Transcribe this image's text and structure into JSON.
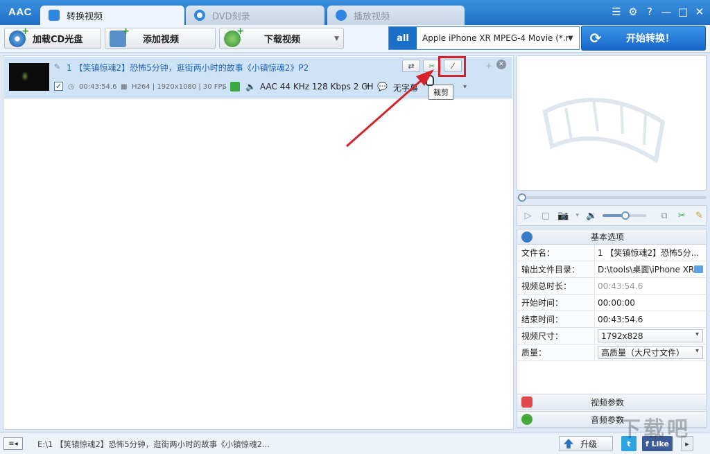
{
  "app": {
    "logo": "AAC"
  },
  "tabs": [
    {
      "label": "转换视频",
      "active": true,
      "icon": "convert-icon"
    },
    {
      "label": "DVD刻录",
      "active": false,
      "icon": "disc-icon"
    },
    {
      "label": "播放视频",
      "active": false,
      "icon": "play-icon"
    }
  ],
  "window_controls": {
    "menu": "☰",
    "settings": "⚙",
    "help": "?",
    "minimize": "—",
    "maximize": "□",
    "close": "✕"
  },
  "toolbar": {
    "load_cd": "加载CD光盘",
    "add_video": "添加视频",
    "download_video": "下载视频",
    "profile_icon_text": "all",
    "profile": "Apple iPhone XR MPEG-4 Movie (*.m...",
    "start": "开始转换！"
  },
  "file": {
    "index": "1",
    "name": "【笑镇惊魂2】恐怖5分钟，逛街两小时的故事《小镇惊魂2》P2",
    "duration": "00:43:54.6",
    "video_info": "H264 | 1920x1080 | 30 FPS",
    "audio": "AAC 44 KHz 128 Kbps 2 CH",
    "subtitle": "无字幕",
    "checked_mark": "✓"
  },
  "tooltip": "裁剪",
  "props": {
    "header": "基本选项",
    "rows": [
      {
        "key": "文件名：",
        "value": "1 【笑镇惊魂2】恐怖5分...",
        "type": "text"
      },
      {
        "key": "输出文件目录：",
        "value": "D:\\tools\\桌面\\iPhone XR",
        "type": "folder"
      },
      {
        "key": "视频总时长：",
        "value": "00:43:54.6",
        "type": "gray"
      },
      {
        "key": "开始时间：",
        "value": "00:00:00",
        "type": "text"
      },
      {
        "key": "结束时间：",
        "value": "00:43:54.6",
        "type": "text"
      },
      {
        "key": "视频尺寸：",
        "value": "1792x828",
        "type": "select"
      },
      {
        "key": "质量：",
        "value": "高质量（大尺寸文件）",
        "type": "select"
      }
    ],
    "video_params": "视频参数",
    "audio_params": "音频参数"
  },
  "player": {
    "seek_progress": 0.0,
    "volume": 0.5
  },
  "statusbar": {
    "toggle": "≡◂",
    "path": "E:\\1 【笑镇惊魂2】恐怖5分钟，逛街两小时的故事《小镇惊魂2...",
    "upgrade": "升级",
    "twitter": "t",
    "facebook": "f Like",
    "next": "▸"
  },
  "colors": {
    "accent": "#1f6fc4",
    "highlight": "#d4232a",
    "link": "#1f62b5"
  },
  "watermark": "下载吧"
}
